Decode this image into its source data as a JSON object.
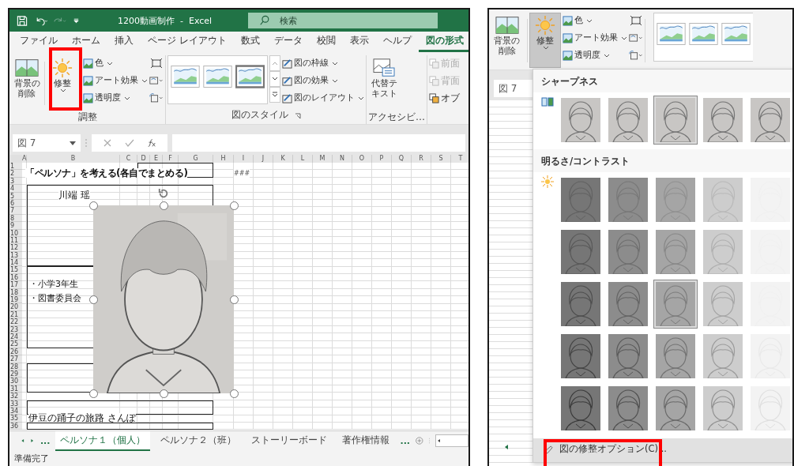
{
  "left": {
    "title": "1200動画制作  -  Excel",
    "search": {
      "placeholder": "検索"
    },
    "tabs": [
      {
        "label": "ファイル",
        "selected": false
      },
      {
        "label": "ホーム",
        "selected": false
      },
      {
        "label": "挿入",
        "selected": false
      },
      {
        "label": "ページ レイアウト",
        "selected": false
      },
      {
        "label": "数式",
        "selected": false
      },
      {
        "label": "データ",
        "selected": false
      },
      {
        "label": "校閲",
        "selected": false
      },
      {
        "label": "表示",
        "selected": false
      },
      {
        "label": "ヘルプ",
        "selected": false
      },
      {
        "label": "図の形式",
        "selected": true
      }
    ],
    "ribbon": {
      "remove_background": "背景の削除",
      "corrections": {
        "label": "修整",
        "pressed": false
      },
      "adjust_commands": [
        "色",
        "アート効果",
        "透明度"
      ],
      "adjust_label": "調整",
      "styles_commands": [
        "図の枠線",
        "図の効果",
        "図のレイアウト"
      ],
      "styles_label": "図のスタイル",
      "alt_text": "代替テキスト",
      "accessibility_label": "アクセシビ…",
      "arrange_commands": [
        {
          "label": "前面",
          "disabled": true
        },
        {
          "label": "背面",
          "disabled": true
        },
        {
          "label": "オブ",
          "disabled": false
        }
      ]
    },
    "name_box": "図 7",
    "sheet": {
      "columns": [
        "A",
        "B",
        "C",
        "D",
        "E",
        "F",
        "G",
        "H",
        "I",
        "J",
        "K",
        "L",
        "M",
        "N",
        "O",
        "P",
        "Q",
        "R",
        "S",
        "T"
      ],
      "rows": [
        "1",
        "2",
        "3",
        "4",
        "5",
        "6",
        "7",
        "8",
        "9",
        "10",
        "11",
        "12",
        "13",
        "14",
        "15",
        "16",
        "17",
        "18",
        "19",
        "20",
        "21",
        "22",
        "23",
        "24",
        "25",
        "26",
        "27",
        "28",
        "29",
        "30",
        "31",
        "32",
        "33",
        "34",
        "35",
        "36"
      ],
      "cells": [
        "「ペルソナ」を考える(各自でまとめる)",
        "###",
        "川端 瑶",
        "・小学3年生",
        "・図書委員会",
        "伊豆の踊子の旅路 さんぽ"
      ]
    },
    "sheet_nav_more": "...",
    "sheet_tabs": [
      {
        "label": "ペルソナ１（個人）",
        "selected": true
      },
      {
        "label": "ペルソナ２（班）",
        "selected": false
      },
      {
        "label": "ストーリーボード",
        "selected": false
      },
      {
        "label": "著作権情報",
        "selected": false
      }
    ],
    "sheet_tabs_more": "...",
    "status": "準備完了"
  },
  "right": {
    "ribbon": {
      "remove_background": "背景の削除",
      "corrections": {
        "label": "修整",
        "pressed": true
      },
      "adjust_commands": [
        "色",
        "アート効果",
        "透明度"
      ]
    },
    "name_box": "図 7",
    "menu": {
      "sections": [
        {
          "title": "シャープネス",
          "kind": "sharpness",
          "presets": [
            {
              "selected": false
            },
            {
              "selected": false
            },
            {
              "selected": true
            },
            {
              "selected": false
            },
            {
              "selected": false
            }
          ]
        },
        {
          "title": "明るさ/コントラスト",
          "kind": "brightness",
          "presets": [
            {
              "selected": false
            },
            {
              "selected": false
            },
            {
              "selected": false
            },
            {
              "selected": false
            },
            {
              "selected": false
            },
            {
              "selected": false
            },
            {
              "selected": false
            },
            {
              "selected": false
            },
            {
              "selected": false
            },
            {
              "selected": false
            },
            {
              "selected": false
            },
            {
              "selected": false
            },
            {
              "selected": true
            },
            {
              "selected": false
            },
            {
              "selected": false
            },
            {
              "selected": false
            },
            {
              "selected": false
            },
            {
              "selected": false
            },
            {
              "selected": false
            },
            {
              "selected": false
            },
            {
              "selected": false
            },
            {
              "selected": false
            },
            {
              "selected": false
            },
            {
              "selected": false
            },
            {
              "selected": false
            }
          ]
        }
      ],
      "footer": "図の修整オプション(C)..."
    }
  }
}
